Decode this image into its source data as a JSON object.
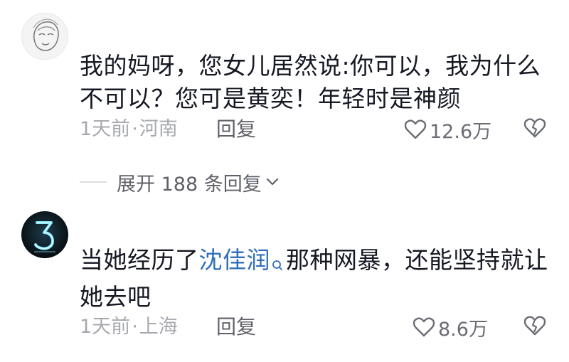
{
  "comments": [
    {
      "text": "我的妈呀，您女儿居然说:你可以，我为什么不可以？您可是黄奕！年轻时是神颜",
      "time": "1天前",
      "separator": "·",
      "location": "河南",
      "reply_label": "回复",
      "likes": "12.6万",
      "expand_label": "展开 188 条回复"
    },
    {
      "text_before": "当她经历了",
      "mention": "沈佳润",
      "text_after": "那种网暴，还能坚持就让她去吧",
      "time": "1天前",
      "separator": "·",
      "location": "上海",
      "reply_label": "回复",
      "likes": "8.6万"
    }
  ],
  "icons": {
    "like": "heart-outline-icon",
    "dislike": "broken-heart-icon",
    "expand": "chevron-down-icon",
    "mention": "search-icon"
  },
  "colors": {
    "text": "#161823",
    "meta": "#a7a9ae",
    "mention": "#2f6fb7"
  }
}
